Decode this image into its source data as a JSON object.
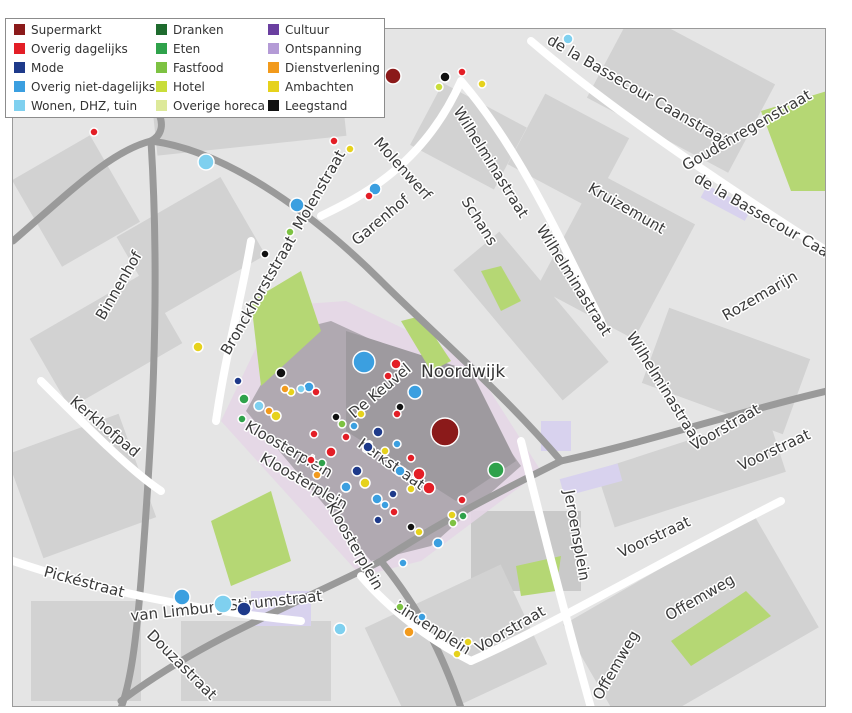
{
  "legend": {
    "items": [
      {
        "key": "supermarkt",
        "label": "Supermarkt",
        "color": "#8b1a1a"
      },
      {
        "key": "overig_dagelijks",
        "label": "Overig dagelijks",
        "color": "#e31e26"
      },
      {
        "key": "mode",
        "label": "Mode",
        "color": "#1e3a8a"
      },
      {
        "key": "overig_niet_dagelijks",
        "label": "Overig niet-dagelijks",
        "color": "#3b9fe0"
      },
      {
        "key": "wonen",
        "label": "Wonen, DHZ, tuin",
        "color": "#7fd0ef"
      },
      {
        "key": "dranken",
        "label": "Dranken",
        "color": "#1e6b2e"
      },
      {
        "key": "eten",
        "label": "Eten",
        "color": "#2fa24b"
      },
      {
        "key": "fastfood",
        "label": "Fastfood",
        "color": "#7dc242"
      },
      {
        "key": "hotel",
        "label": "Hotel",
        "color": "#c9dd3a"
      },
      {
        "key": "overige_horeca",
        "label": "Overige horeca",
        "color": "#dde99a"
      },
      {
        "key": "cultuur",
        "label": "Cultuur",
        "color": "#6a3fa0"
      },
      {
        "key": "ontspanning",
        "label": "Ontspanning",
        "color": "#b49bd6"
      },
      {
        "key": "dienstverlening",
        "label": "Dienstverlening",
        "color": "#f29a1c"
      },
      {
        "key": "ambachten",
        "label": "Ambachten",
        "color": "#e6d21c"
      },
      {
        "key": "leegstand",
        "label": "Leegstand",
        "color": "#111111"
      }
    ]
  },
  "place_label": "Noordwijk",
  "streets": [
    {
      "text": "de la Bassecour Caanstraat"
    },
    {
      "text": "Goudenregenstraat"
    },
    {
      "text": "de la Bassecour Caanstraat"
    },
    {
      "text": "Kruizemunt"
    },
    {
      "text": "Rozemarijn"
    },
    {
      "text": "Wilhelminastraat"
    },
    {
      "text": "Wilhelminastraat"
    },
    {
      "text": "Wilhelminastraat"
    },
    {
      "text": "Schans"
    },
    {
      "text": "Molenwerf"
    },
    {
      "text": "Garenhof"
    },
    {
      "text": "Molenstraat"
    },
    {
      "text": "Bronckhorststraat"
    },
    {
      "text": "Binnenhof"
    },
    {
      "text": "Kerkhofpad"
    },
    {
      "text": "Kloosterplein"
    },
    {
      "text": "Kloosterplein"
    },
    {
      "text": "Kloosterplein"
    },
    {
      "text": "De Keuvel"
    },
    {
      "text": "Kerkstraat"
    },
    {
      "text": "Jeroensplein"
    },
    {
      "text": "Voorstraat"
    },
    {
      "text": "Voorstraat"
    },
    {
      "text": "Voorstraat"
    },
    {
      "text": "Voorstraat"
    },
    {
      "text": "Offemweg"
    },
    {
      "text": "Offemweg"
    },
    {
      "text": "Lindenplein"
    },
    {
      "text": "Pickéstraat"
    },
    {
      "text": "van Limburg Stirumstraat"
    },
    {
      "text": "Douzastraat"
    }
  ]
}
